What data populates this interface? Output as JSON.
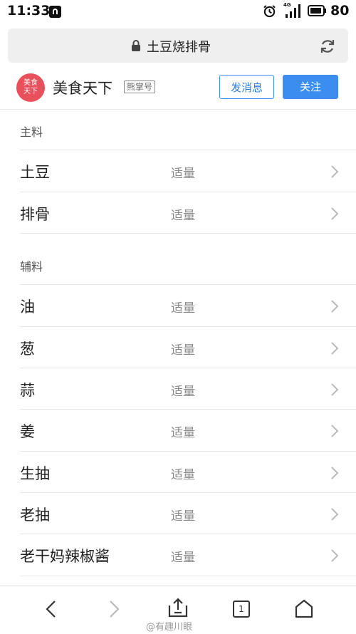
{
  "status_bar": {
    "time": "11:33",
    "network": "4G",
    "battery": "80"
  },
  "url_bar": {
    "title": "土豆烧排骨"
  },
  "account": {
    "avatar_text": "美食\n天下",
    "name": "美食天下",
    "tag": "熊掌号",
    "message_label": "发消息",
    "follow_label": "关注"
  },
  "sections": [
    {
      "title": "主料",
      "items": [
        {
          "name": "土豆",
          "amount": "适量"
        },
        {
          "name": "排骨",
          "amount": "适量"
        }
      ]
    },
    {
      "title": "辅料",
      "items": [
        {
          "name": "油",
          "amount": "适量"
        },
        {
          "name": "葱",
          "amount": "适量"
        },
        {
          "name": "蒜",
          "amount": "适量"
        },
        {
          "name": "姜",
          "amount": "适量"
        },
        {
          "name": "生抽",
          "amount": "适量"
        },
        {
          "name": "老抽",
          "amount": "适量"
        },
        {
          "name": "老干妈辣椒酱",
          "amount": "适量"
        }
      ]
    }
  ],
  "toolbar": {
    "tab_count": "1",
    "watermark": "@有趣川眼"
  },
  "colors": {
    "accent": "#3b8ef0",
    "avatar": "#e8505b"
  }
}
